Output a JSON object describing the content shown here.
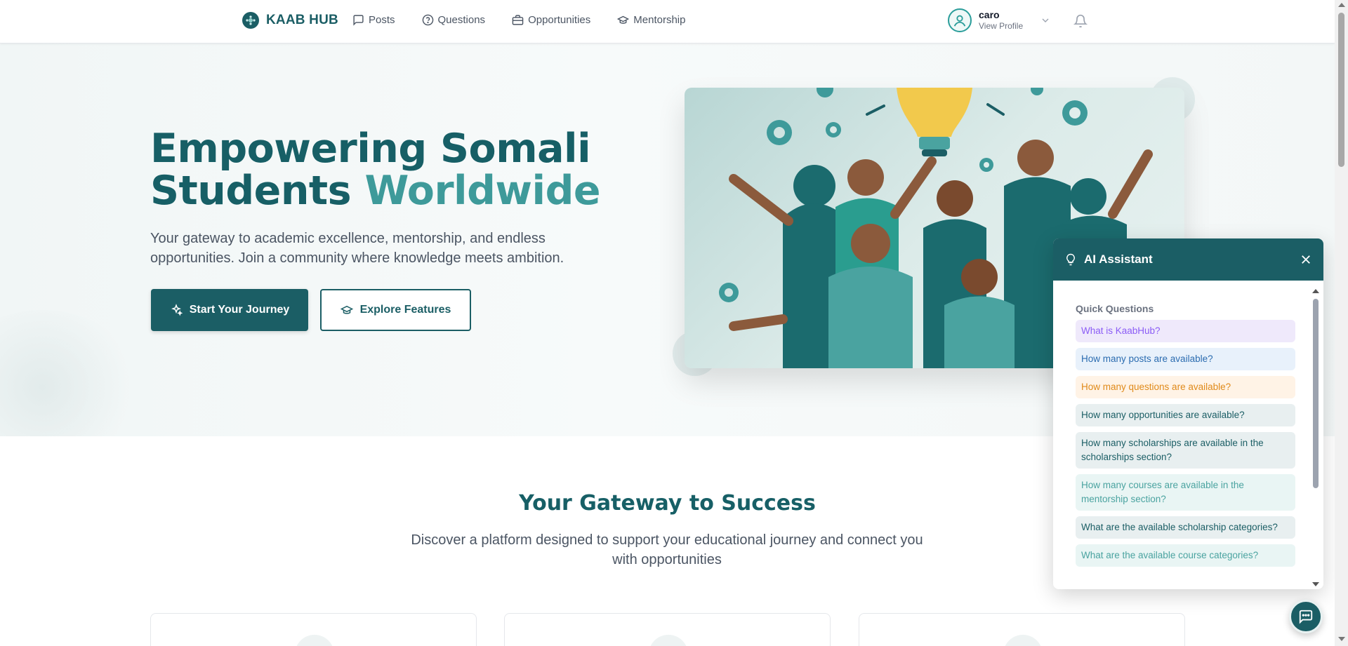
{
  "navbar": {
    "brand": "KAAB HUB",
    "links": [
      {
        "label": "Posts",
        "icon": "chat-bubble-icon"
      },
      {
        "label": "Questions",
        "icon": "question-circle-icon"
      },
      {
        "label": "Opportunities",
        "icon": "briefcase-icon"
      },
      {
        "label": "Mentorship",
        "icon": "graduation-cap-icon"
      }
    ],
    "profile": {
      "name": "caro",
      "subtitle": "View Profile"
    }
  },
  "hero": {
    "title_line1": "Empowering Somali",
    "title_line2_plain": "Students ",
    "title_line2_accent": "Worldwide",
    "description": "Your gateway to academic excellence, mentorship, and endless opportunities. Join a community where knowledge meets ambition.",
    "primary_button": "Start Your Journey",
    "secondary_button": "Explore Features"
  },
  "gateway": {
    "title": "Your Gateway to Success",
    "subtitle": "Discover a platform designed to support your educational journey and connect you with opportunities"
  },
  "ai_assistant": {
    "title": "AI Assistant",
    "quick_label": "Quick Questions",
    "questions": [
      {
        "text": "What is KaabHub?",
        "bg": "#efe9fb",
        "color": "#8b5cf6"
      },
      {
        "text": "How many posts are available?",
        "bg": "#e8f1fb",
        "color": "#2b6cb0"
      },
      {
        "text": "How many questions are available?",
        "bg": "#fff3e6",
        "color": "#e08a1a"
      },
      {
        "text": "How many opportunities are available?",
        "bg": "#e8eff0",
        "color": "#1b5e65"
      },
      {
        "text": "How many scholarships are available in the scholarships section?",
        "bg": "#e8eff0",
        "color": "#1b5e65"
      },
      {
        "text": "How many courses are available in the mentorship section?",
        "bg": "#e9f5f4",
        "color": "#4aa3a0"
      },
      {
        "text": "What are the available scholarship categories?",
        "bg": "#e8eff0",
        "color": "#1b5e65"
      },
      {
        "text": "What are the available course categories?",
        "bg": "#e9f5f4",
        "color": "#4aa3a0"
      }
    ]
  },
  "colors": {
    "brand": "#1b5e65",
    "accent": "#3e9a9a"
  }
}
